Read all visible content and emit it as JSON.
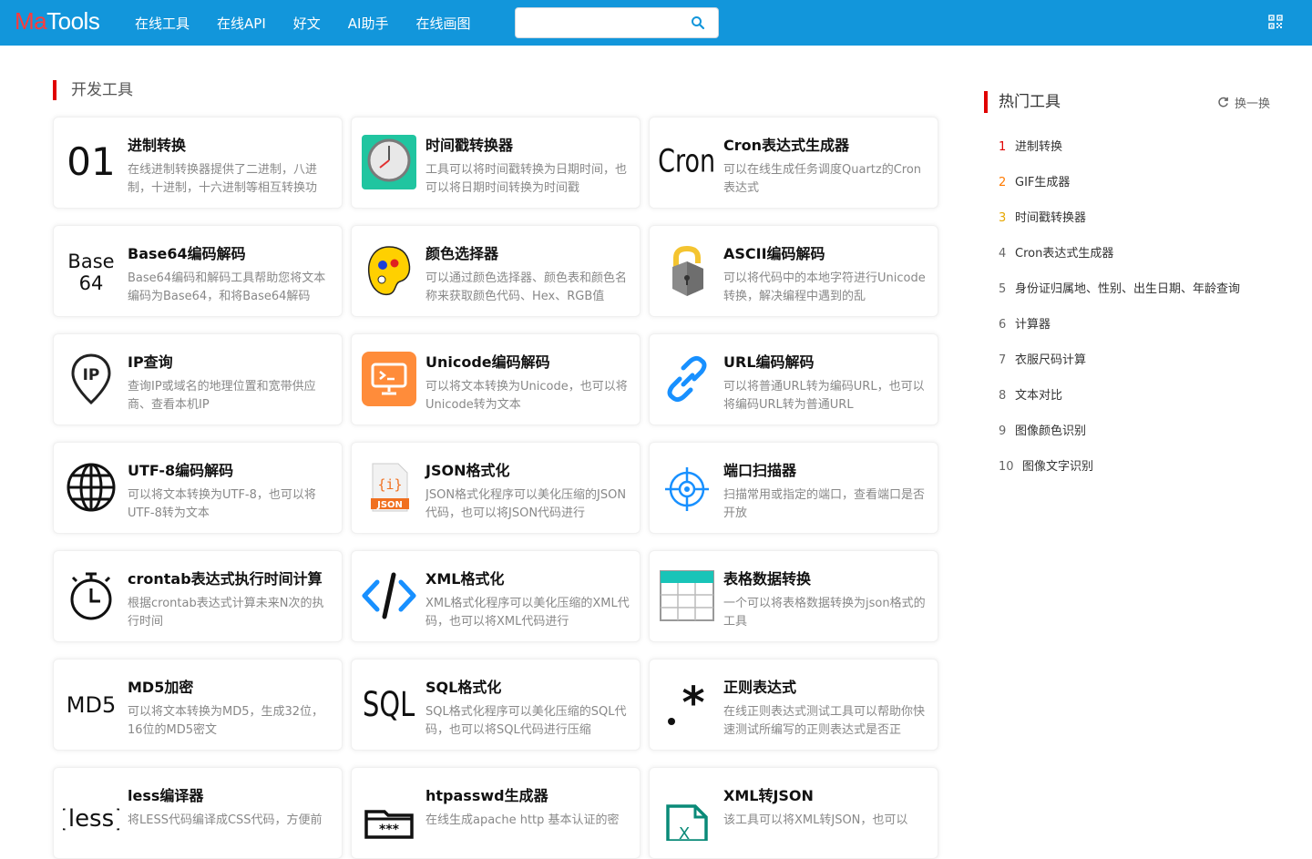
{
  "header": {
    "logo_ma": "Ma",
    "logo_tools": "Tools",
    "nav": [
      "在线工具",
      "在线API",
      "好文",
      "AI助手",
      "在线画图"
    ],
    "search_value": "",
    "search_placeholder": "",
    "accent_color": "#1296db"
  },
  "main": {
    "section_title": "开发工具",
    "cards": [
      {
        "name": "进制转换",
        "desc": "在线进制转换器提供了二进制，八进制，十进制，十六进制等相互转换功",
        "icon": "01-text-icon"
      },
      {
        "name": "时间戳转换器",
        "desc": "工具可以将时间戳转换为日期时间，也可以将日期时间转换为时间戳",
        "icon": "clock-icon"
      },
      {
        "name": "Cron表达式生成器",
        "desc": "可以在线生成任务调度Quartz的Cron表达式",
        "icon": "cron-text-icon"
      },
      {
        "name": "Base64编码解码",
        "desc": "Base64编码和解码工具帮助您将文本编码为Base64，和将Base64解码",
        "icon": "base64-text-icon"
      },
      {
        "name": "颜色选择器",
        "desc": "可以通过颜色选择器、颜色表和颜色名称来获取颜色代码、Hex、RGB值",
        "icon": "palette-icon"
      },
      {
        "name": "ASCII编码解码",
        "desc": "可以将代码中的本地字符进行Unicode转换，解决编程中遇到的乱",
        "icon": "lock-icon"
      },
      {
        "name": "IP查询",
        "desc": "查询IP或域名的地理位置和宽带供应商、查看本机IP",
        "icon": "ip-pin-icon"
      },
      {
        "name": "Unicode编码解码",
        "desc": "可以将文本转换为Unicode，也可以将Unicode转为文本",
        "icon": "monitor-code-icon"
      },
      {
        "name": "URL编码解码",
        "desc": "可以将普通URL转为编码URL，也可以将编码URL转为普通URL",
        "icon": "link-icon"
      },
      {
        "name": "UTF-8编码解码",
        "desc": "可以将文本转换为UTF-8，也可以将UTF-8转为文本",
        "icon": "globe-icon"
      },
      {
        "name": "JSON格式化",
        "desc": "JSON格式化程序可以美化压缩的JSON代码，也可以将JSON代码进行",
        "icon": "json-file-icon"
      },
      {
        "name": "端口扫描器",
        "desc": "扫描常用或指定的端口，查看端口是否开放",
        "icon": "crosshair-icon"
      },
      {
        "name": "crontab表达式执行时间计算",
        "desc": "根据crontab表达式计算未来N次的执行时间",
        "icon": "stopwatch-icon"
      },
      {
        "name": "XML格式化",
        "desc": "XML格式化程序可以美化压缩的XML代码，也可以将XML代码进行",
        "icon": "code-brackets-icon"
      },
      {
        "name": "表格数据转换",
        "desc": "一个可以将表格数据转换为json格式的工具",
        "icon": "table-icon"
      },
      {
        "name": "MD5加密",
        "desc": "可以将文本转换为MD5，生成32位，16位的MD5密文",
        "icon": "md5-text-icon"
      },
      {
        "name": "SQL格式化",
        "desc": "SQL格式化程序可以美化压缩的SQL代码，也可以将SQL代码进行压缩",
        "icon": "sql-text-icon"
      },
      {
        "name": "正则表达式",
        "desc": "在线正则表达式测试工具可以帮助你快速测试所编写的正则表达式是否正",
        "icon": "regex-icon"
      },
      {
        "name": "less编译器",
        "desc": "将LESS代码编译成CSS代码，方便前",
        "icon": "less-text-icon"
      },
      {
        "name": "htpasswd生成器",
        "desc": "在线生成apache http 基本认证的密",
        "icon": "folder-password-icon"
      },
      {
        "name": "XML转JSON",
        "desc": "该工具可以将XML转JSON，也可以",
        "icon": "xml-file-icon"
      }
    ]
  },
  "sidebar": {
    "title": "热门工具",
    "refresh_label": "换一换",
    "items": [
      {
        "num": "1",
        "label": "进制转换"
      },
      {
        "num": "2",
        "label": "GIF生成器"
      },
      {
        "num": "3",
        "label": "时间戳转换器"
      },
      {
        "num": "4",
        "label": "Cron表达式生成器"
      },
      {
        "num": "5",
        "label": "身份证归属地、性别、出生日期、年龄查询"
      },
      {
        "num": "6",
        "label": "计算器"
      },
      {
        "num": "7",
        "label": "衣服尺码计算"
      },
      {
        "num": "8",
        "label": "文本对比"
      },
      {
        "num": "9",
        "label": "图像颜色识别"
      },
      {
        "num": "10",
        "label": "图像文字识别"
      }
    ]
  }
}
